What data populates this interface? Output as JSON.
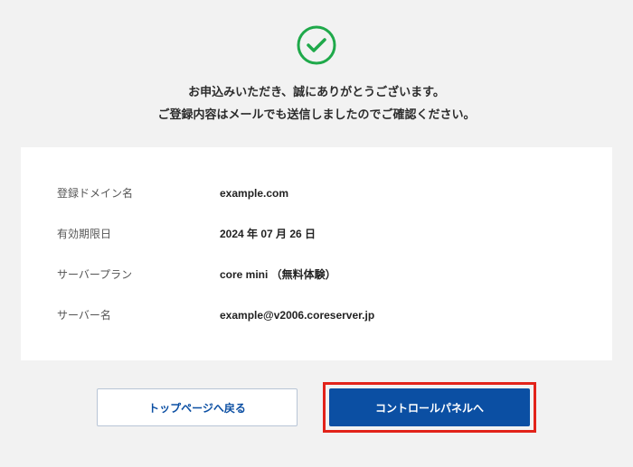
{
  "messages": {
    "line1": "お申込みいただき、誠にありがとうございます。",
    "line2": "ご登録内容はメールでも送信しましたのでご確認ください。"
  },
  "details": {
    "domain": {
      "label": "登録ドメイン名",
      "value": "example.com"
    },
    "expiry": {
      "label": "有効期限日",
      "value": "2024 年 07 月 26 日"
    },
    "plan": {
      "label": "サーバープラン",
      "value": "core mini （無料体験）"
    },
    "server": {
      "label": "サーバー名",
      "value": "example@v2006.coreserver.jp"
    }
  },
  "buttons": {
    "back": "トップページへ戻る",
    "control_panel": "コントロールパネルへ"
  }
}
